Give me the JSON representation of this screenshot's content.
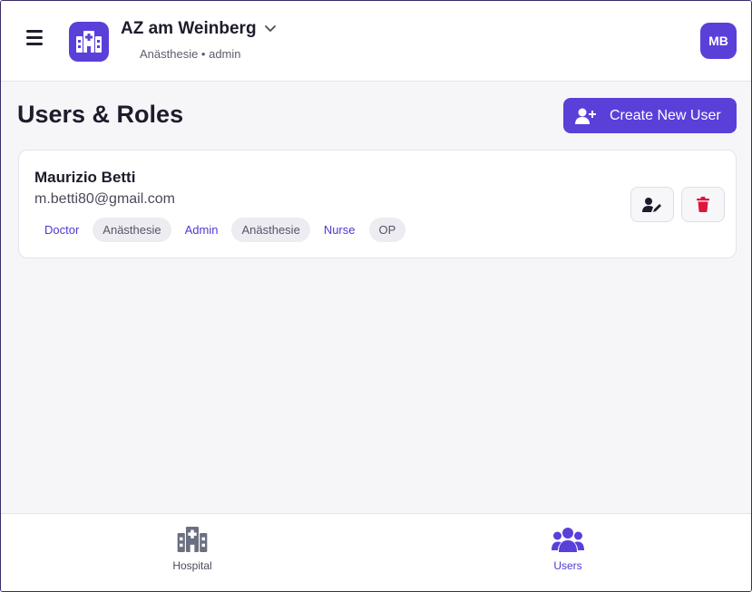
{
  "header": {
    "hospital_name": "AZ am Weinberg",
    "hospital_sub": "Anästhesie • admin",
    "avatar_initials": "MB"
  },
  "page": {
    "title": "Users & Roles",
    "create_button_label": "Create New User"
  },
  "users": [
    {
      "name": "Maurizio Betti",
      "email": "m.betti80@gmail.com",
      "assignments": [
        {
          "role": "Doctor",
          "unit": "Anästhesie"
        },
        {
          "role": "Admin",
          "unit": "Anästhesie"
        },
        {
          "role": "Nurse",
          "unit": "OP"
        }
      ]
    }
  ],
  "bottom_nav": {
    "items": [
      {
        "label": "Hospital",
        "icon": "hospital-icon",
        "active": false
      },
      {
        "label": "Users",
        "icon": "users-icon",
        "active": true
      }
    ]
  },
  "colors": {
    "accent": "#5b3fd9",
    "role_text": "#4b3ad0",
    "delete": "#e0143c",
    "nav_inactive": "#6b6f80"
  }
}
